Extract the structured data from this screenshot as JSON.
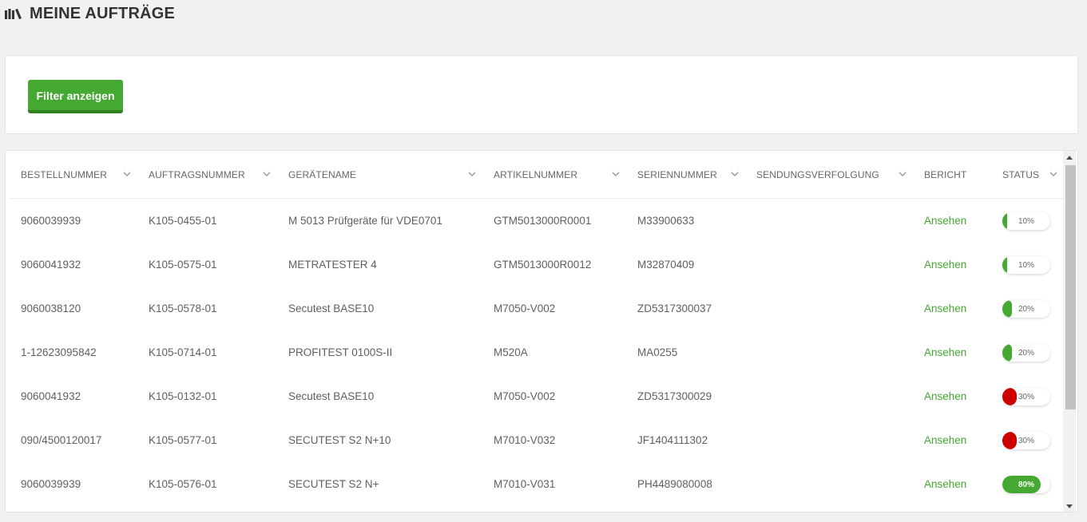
{
  "page": {
    "title": "MEINE AUFTRÄGE",
    "logo_icon": "books-icon"
  },
  "filter": {
    "button_label": "Filter anzeigen"
  },
  "table": {
    "columns": [
      {
        "key": "bestellnummer",
        "label": "BESTELLNUMMER",
        "sortable": true
      },
      {
        "key": "auftragsnummer",
        "label": "AUFTRAGSNUMMER",
        "sortable": true
      },
      {
        "key": "geraetename",
        "label": "GERÄTENAME",
        "sortable": true
      },
      {
        "key": "artikelnummer",
        "label": "ARTIKELNUMMER",
        "sortable": true
      },
      {
        "key": "seriennummer",
        "label": "SERIENNUMMER",
        "sortable": true
      },
      {
        "key": "sendungsverfolgung",
        "label": "SENDUNGSVERFOLGUNG",
        "sortable": true
      },
      {
        "key": "bericht",
        "label": "BERICHT",
        "sortable": false
      },
      {
        "key": "status",
        "label": "STATUS",
        "sortable": true
      }
    ],
    "rows": [
      {
        "bestellnummer": "9060039939",
        "auftragsnummer": "K105-0455-01",
        "geraetename": "M 5013 Prüfgeräte für VDE0701",
        "artikelnummer": "GTM5013000R0001",
        "seriennummer": "M33900633",
        "sendungsverfolgung": "",
        "bericht": "Ansehen",
        "status_label": "10%",
        "status_value": 0.1,
        "status_color": "#44a832"
      },
      {
        "bestellnummer": "9060041932",
        "auftragsnummer": "K105-0575-01",
        "geraetename": "METRATESTER 4",
        "artikelnummer": "GTM5013000R0012",
        "seriennummer": "M32870409",
        "sendungsverfolgung": "",
        "bericht": "Ansehen",
        "status_label": "10%",
        "status_value": 0.1,
        "status_color": "#44a832"
      },
      {
        "bestellnummer": "9060038120",
        "auftragsnummer": "K105-0578-01",
        "geraetename": "Secutest BASE10",
        "artikelnummer": "M7050-V002",
        "seriennummer": "ZD5317300037",
        "sendungsverfolgung": "",
        "bericht": "Ansehen",
        "status_label": "20%",
        "status_value": 0.2,
        "status_color": "#44a832"
      },
      {
        "bestellnummer": "1-12623095842",
        "auftragsnummer": "K105-0714-01",
        "geraetename": "PROFITEST 0100S-II",
        "artikelnummer": "M520A",
        "seriennummer": "MA0255",
        "sendungsverfolgung": "",
        "bericht": "Ansehen",
        "status_label": "20%",
        "status_value": 0.2,
        "status_color": "#44a832"
      },
      {
        "bestellnummer": "9060041932",
        "auftragsnummer": "K105-0132-01",
        "geraetename": "Secutest BASE10",
        "artikelnummer": "M7050-V002",
        "seriennummer": "ZD5317300029",
        "sendungsverfolgung": "",
        "bericht": "Ansehen",
        "status_label": "30%",
        "status_value": 0.3,
        "status_color": "#cc0000"
      },
      {
        "bestellnummer": "090/4500120017",
        "auftragsnummer": "K105-0577-01",
        "geraetename": "SECUTEST S2 N+10",
        "artikelnummer": "M7010-V032",
        "seriennummer": "JF1404111302",
        "sendungsverfolgung": "",
        "bericht": "Ansehen",
        "status_label": "30%",
        "status_value": 0.3,
        "status_color": "#cc0000"
      },
      {
        "bestellnummer": "9060039939",
        "auftragsnummer": "K105-0576-01",
        "geraetename": "SECUTEST S2 N+",
        "artikelnummer": "M7010-V031",
        "seriennummer": "PH4489080008",
        "sendungsverfolgung": "",
        "bericht": "Ansehen",
        "status_label": "80%",
        "status_value": 0.8,
        "status_color": "#44a832"
      }
    ]
  }
}
